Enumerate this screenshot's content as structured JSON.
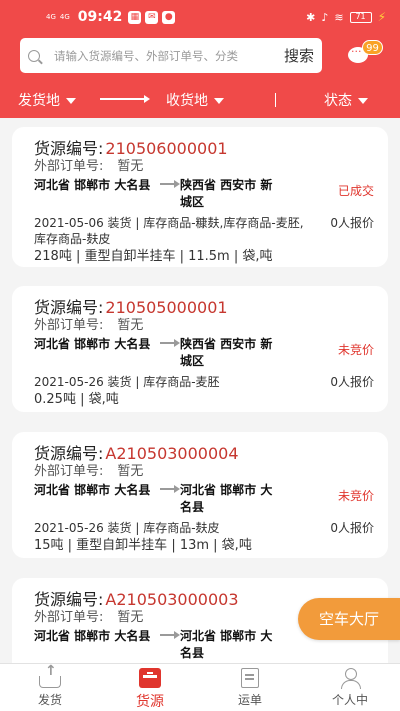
{
  "status_bar": {
    "signal1": "4G",
    "signal2": "4G",
    "time": "09:42",
    "battery": "71"
  },
  "search": {
    "placeholder": "请输入货源编号、外部订单号、分类",
    "button": "搜索"
  },
  "messages": {
    "badge": "99"
  },
  "filters": {
    "origin": "发货地",
    "destination": "收货地",
    "status": "状态"
  },
  "labels": {
    "code": "货源编号:",
    "ext": "外部订单号:"
  },
  "cards": [
    {
      "code": "210506000001",
      "ext_order": "暂无",
      "from": "河北省 邯郸市 大名县",
      "to": "陕西省 西安市 新城区",
      "status": "已成交",
      "info": "2021-05-06 装货 | 库存商品-糠麸,库存商品-麦胚,库存商品-麸皮",
      "quote": "0人报价",
      "detail": "218吨 | 重型自卸半挂车 | 11.5m | 袋,吨"
    },
    {
      "code": "210505000001",
      "ext_order": "暂无",
      "from": "河北省 邯郸市 大名县",
      "to": "陕西省 西安市 新城区",
      "status": "未竞价",
      "info": "2021-05-26 装货 | 库存商品-麦胚",
      "quote": "0人报价",
      "detail": "0.25吨 | 袋,吨"
    },
    {
      "code": "A210503000004",
      "ext_order": "暂无",
      "from": "河北省 邯郸市 大名县",
      "to": "河北省 邯郸市 大名县",
      "status": "未竞价",
      "info": "2021-05-26 装货 | 库存商品-麸皮",
      "quote": "0人报价",
      "detail": "15吨 | 重型自卸半挂车 | 13m | 袋,吨"
    },
    {
      "code": "A210503000003",
      "ext_order": "暂无",
      "from": "河北省 邯郸市 大名县",
      "to": "河北省 邯郸市 大名县",
      "status": "",
      "info": "",
      "quote": "",
      "detail": ""
    }
  ],
  "float_button": "空车大厅",
  "tabs": [
    {
      "label": "发货",
      "icon": "ship-icon"
    },
    {
      "label": "货源",
      "icon": "source-icon"
    },
    {
      "label": "运单",
      "icon": "waybill-icon"
    },
    {
      "label": "个人中",
      "icon": "user-icon"
    }
  ],
  "colors": {
    "primary": "#f04a49",
    "accent_orange": "#f29b3b",
    "status_red": "#e0352d"
  }
}
